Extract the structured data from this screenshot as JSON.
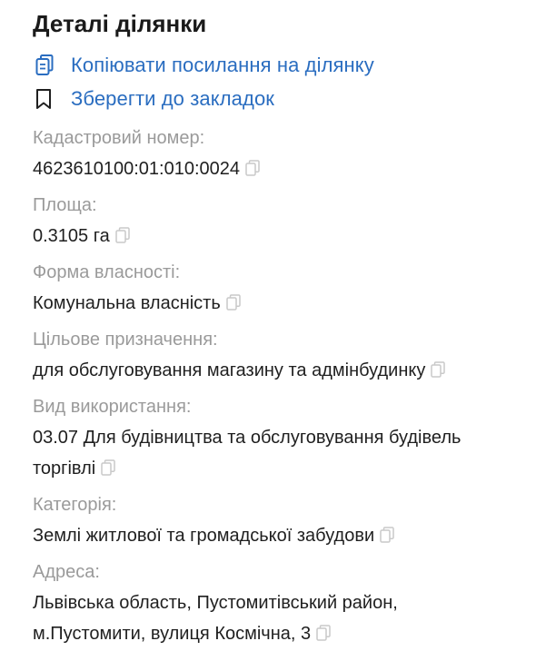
{
  "header": {
    "title": "Деталі ділянки"
  },
  "actions": {
    "copy_link_label": "Копіювати посилання на ділянку",
    "bookmark_label": "Зберегти до закладок"
  },
  "fields": [
    {
      "label": "Кадастровий номер:",
      "value": "4623610100:01:010:0024"
    },
    {
      "label": "Площа:",
      "value": "0.3105 га"
    },
    {
      "label": "Форма власності:",
      "value": "Комунальна власність"
    },
    {
      "label": "Цільове призначення:",
      "value": "для обслуговування магазину та адмінбудинку"
    },
    {
      "label": "Вид використання:",
      "value_line1": "03.07 Для будівництва та обслуговування будівель",
      "value_line2": "торгівлі"
    },
    {
      "label": "Категорія:",
      "value": "Землі житлової та громадської забудови"
    },
    {
      "label": "Адреса:",
      "value_line1": "Львівська область, Пустомитівський район,",
      "value_line2": "м.Пустомити, вулиця Космічна, 3"
    }
  ],
  "colors": {
    "link": "#2a6dc0",
    "label": "#9a9a9a",
    "text": "#1f1f1f",
    "copy_icon": "#c9c9c9"
  },
  "icons": {
    "copy_link": "clipboard-copy-icon",
    "bookmark": "bookmark-icon",
    "copy_value": "copy-icon"
  }
}
